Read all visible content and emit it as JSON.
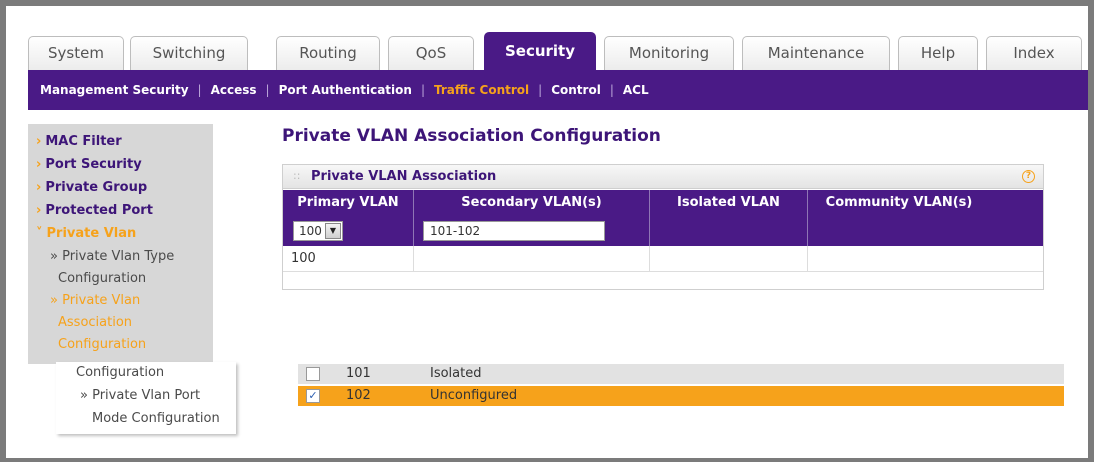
{
  "tabs": [
    "System",
    "Switching",
    "Routing",
    "QoS",
    "Security",
    "Monitoring",
    "Maintenance",
    "Help",
    "Index"
  ],
  "subnav": [
    "Management Security",
    "Access",
    "Port Authentication",
    "Traffic Control",
    "Control",
    "ACL"
  ],
  "active_tab": "Security",
  "active_subnav": "Traffic Control",
  "left_nav": {
    "items": [
      "MAC Filter",
      "Port Security",
      "Private Group",
      "Protected Port",
      "Private Vlan"
    ],
    "sub_items": [
      "» Private Vlan Type",
      "Configuration",
      "» Private Vlan",
      "Association",
      "Configuration"
    ]
  },
  "floating_menu": [
    "Configuration",
    "» Private Vlan Port",
    "Mode Configuration"
  ],
  "page_title": "Private VLAN Association Configuration",
  "panel": {
    "title": "Private VLAN Association",
    "help_icon": "?",
    "columns": [
      "Primary VLAN",
      "Secondary VLAN(s)",
      "Isolated VLAN",
      "Community VLAN(s)"
    ],
    "edit": {
      "primary_select": "100",
      "secondary_input": "101-102"
    },
    "rows": [
      {
        "primary": "100",
        "secondary": "",
        "isolated": "",
        "community": ""
      }
    ]
  },
  "vlan_list": [
    {
      "id": "101",
      "type": "Isolated",
      "checked": false
    },
    {
      "id": "102",
      "type": "Unconfigured",
      "checked": true
    }
  ],
  "colors": {
    "accent": "#4a1a86",
    "highlight": "#f6a21b"
  }
}
